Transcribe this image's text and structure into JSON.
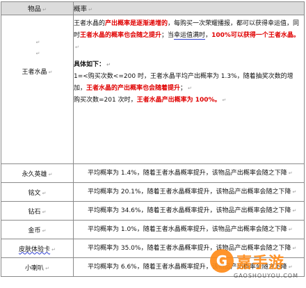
{
  "header": {
    "col_item": "物品",
    "col_prob": "概率"
  },
  "mark": "↵",
  "crystal": {
    "name": "王者水晶",
    "para1": [
      {
        "t": "王者水晶的",
        "s": "n"
      },
      {
        "t": "产出概率是逐渐递增的",
        "s": "r"
      },
      {
        "t": "，每购买一次荣耀播报，都可以获得幸运值，同时",
        "s": "n"
      },
      {
        "t": "王者水晶的概率也会随之提升",
        "s": "r"
      },
      {
        "t": "；当",
        "s": "n"
      },
      {
        "t": "幸运值满时",
        "s": "u"
      },
      {
        "t": "，",
        "s": "n"
      },
      {
        "t": "100%可以获得一个王者水晶。",
        "s": "r"
      }
    ],
    "detail_title": "具体如下：",
    "para2": [
      {
        "t": "1=<购买次数<=200 时，王者水晶平均产出概率为 1.3%，随着抽奖次数的增加，",
        "s": "n"
      },
      {
        "t": "王者水晶的产出概率也会随着提升",
        "s": "r"
      },
      {
        "t": "；",
        "s": "n"
      }
    ],
    "para3": [
      {
        "t": "购买次数=201 次时，",
        "s": "n"
      },
      {
        "t": "王者水晶产出概率为 100%。",
        "s": "r"
      }
    ]
  },
  "rows": [
    {
      "name": "永久英雄",
      "desc": "平均概率为 1.4%，随着王者水晶概率提升，该物品产出概率会随之下降",
      "wavy": false
    },
    {
      "name": "铭文",
      "desc": "平均概率为 20.1%，随着王者水晶概率提升，该物品产出概率会随之下降",
      "wavy": false
    },
    {
      "name": "钻石",
      "desc": "平均概率为 34.6%，随着王者水晶概率提升，该物品产出概率会随之下降",
      "wavy": false
    },
    {
      "name": "金币",
      "desc": "平均概率为 1.0%，随着王者水晶概率提升，该物品产出概率会随之下降",
      "wavy": false
    },
    {
      "name": "皮肤体验卡",
      "desc": "平均概率为 35.0%，随着王者水晶概率提升，该物品产出概率会随之下降",
      "wavy": true
    },
    {
      "name": "小喇叭",
      "desc": "平均概率为 6.6%，随着王者水晶概率提升，该物品产出概率会随之下降",
      "wavy": false
    }
  ],
  "watermark": {
    "logo_char": "G",
    "brand": "嘉手游",
    "url": "GAOSHOUYOU.COM"
  }
}
